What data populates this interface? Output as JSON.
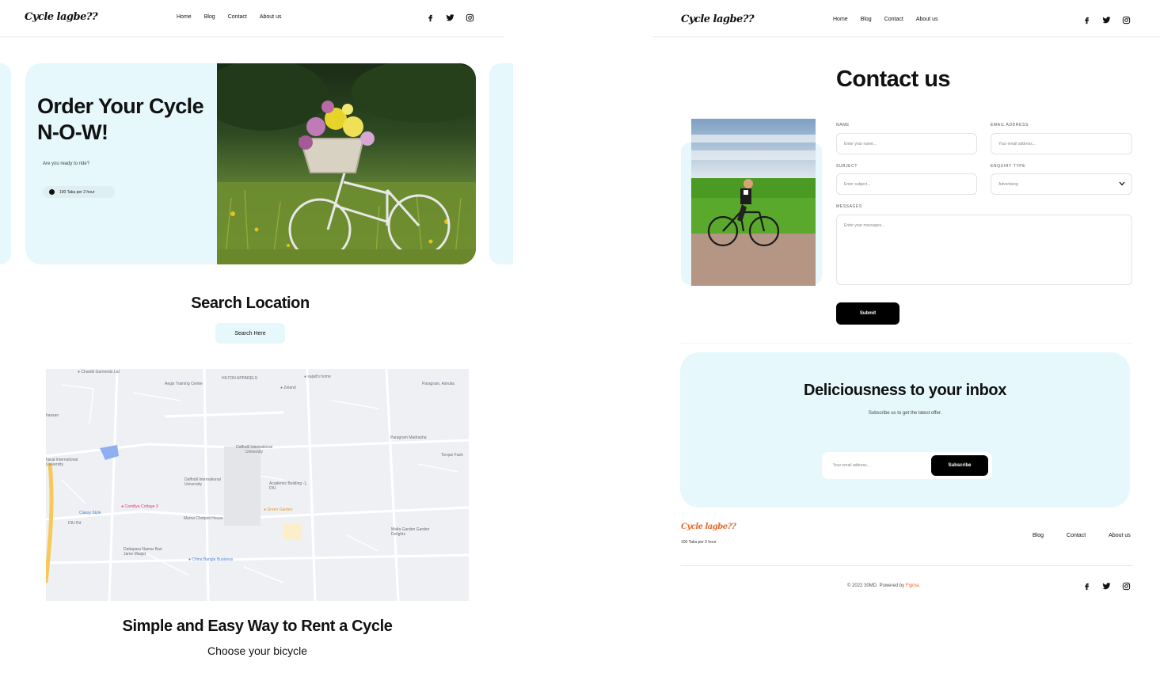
{
  "brand": "Cycle lagbe??",
  "nav": [
    "Home",
    "Blog",
    "Contact",
    "About us"
  ],
  "social_icons": [
    "facebook-icon",
    "twitter-icon",
    "instagram-icon"
  ],
  "hero": {
    "title_line1": "Order Your Cycle",
    "title_line2": "N-O-W!",
    "subtitle": "Are you ready to ride?",
    "badge": "100 Taka per 2 hour",
    "image_label": "bicycle-with-flower-basket-in-meadow"
  },
  "search": {
    "heading": "Search Location",
    "button": "Search Here"
  },
  "map": {
    "labels": [
      "Chanlik Garments Ltd",
      "Aegis Training Center",
      "HILTON APPARELS",
      "sajad's home",
      "Zeland",
      "Paragram, Ashulia",
      "hassan",
      "Paragram Madrasha",
      "Torque Fash",
      "Daffodil International University",
      "harat International University",
      "Daffodil International University",
      "Academic Building -1, DIU",
      "Camiliya Cottage 3",
      "Classy Style",
      "Green Garden",
      "Mama Chotpoti House",
      "Malta Garden Garden Delights",
      "DIU Rd",
      "Dattapara Namar Bari Jame Masjid",
      "China Bangla Business"
    ]
  },
  "rent": {
    "heading": "Simple and Easy Way to Rent a Cycle",
    "sub": "Choose your bicycle"
  },
  "contact": {
    "heading": "Contact us",
    "name_label": "NAME",
    "name_placeholder": "Enter your name...",
    "email_label": "EMAIL ADDRESS",
    "email_placeholder": "Your email address...",
    "subject_label": "SUBJECT",
    "subject_placeholder": "Enter subject...",
    "enquiry_label": "ENQUIRY TYPE",
    "enquiry_value": "Advertising",
    "messages_label": "MESSAGES",
    "messages_placeholder": "Enter your messages...",
    "submit": "Submit"
  },
  "newsletter": {
    "heading": "Deliciousness to your inbox",
    "sub": "Subscribe us to get the latest offer.",
    "placeholder": "Your email address...",
    "button": "Subscribe"
  },
  "footer": {
    "brand": "Cycle lagbe??",
    "tagline": "100 Taka per 2 hour",
    "links": [
      "Blog",
      "Contact",
      "About us"
    ],
    "copyright": "© 2022 30MD. Powered by ",
    "powered": "Figma."
  },
  "colors": {
    "hero_bg": "#e6f8fc",
    "accent_orange": "#e8682a",
    "black": "#000000"
  }
}
